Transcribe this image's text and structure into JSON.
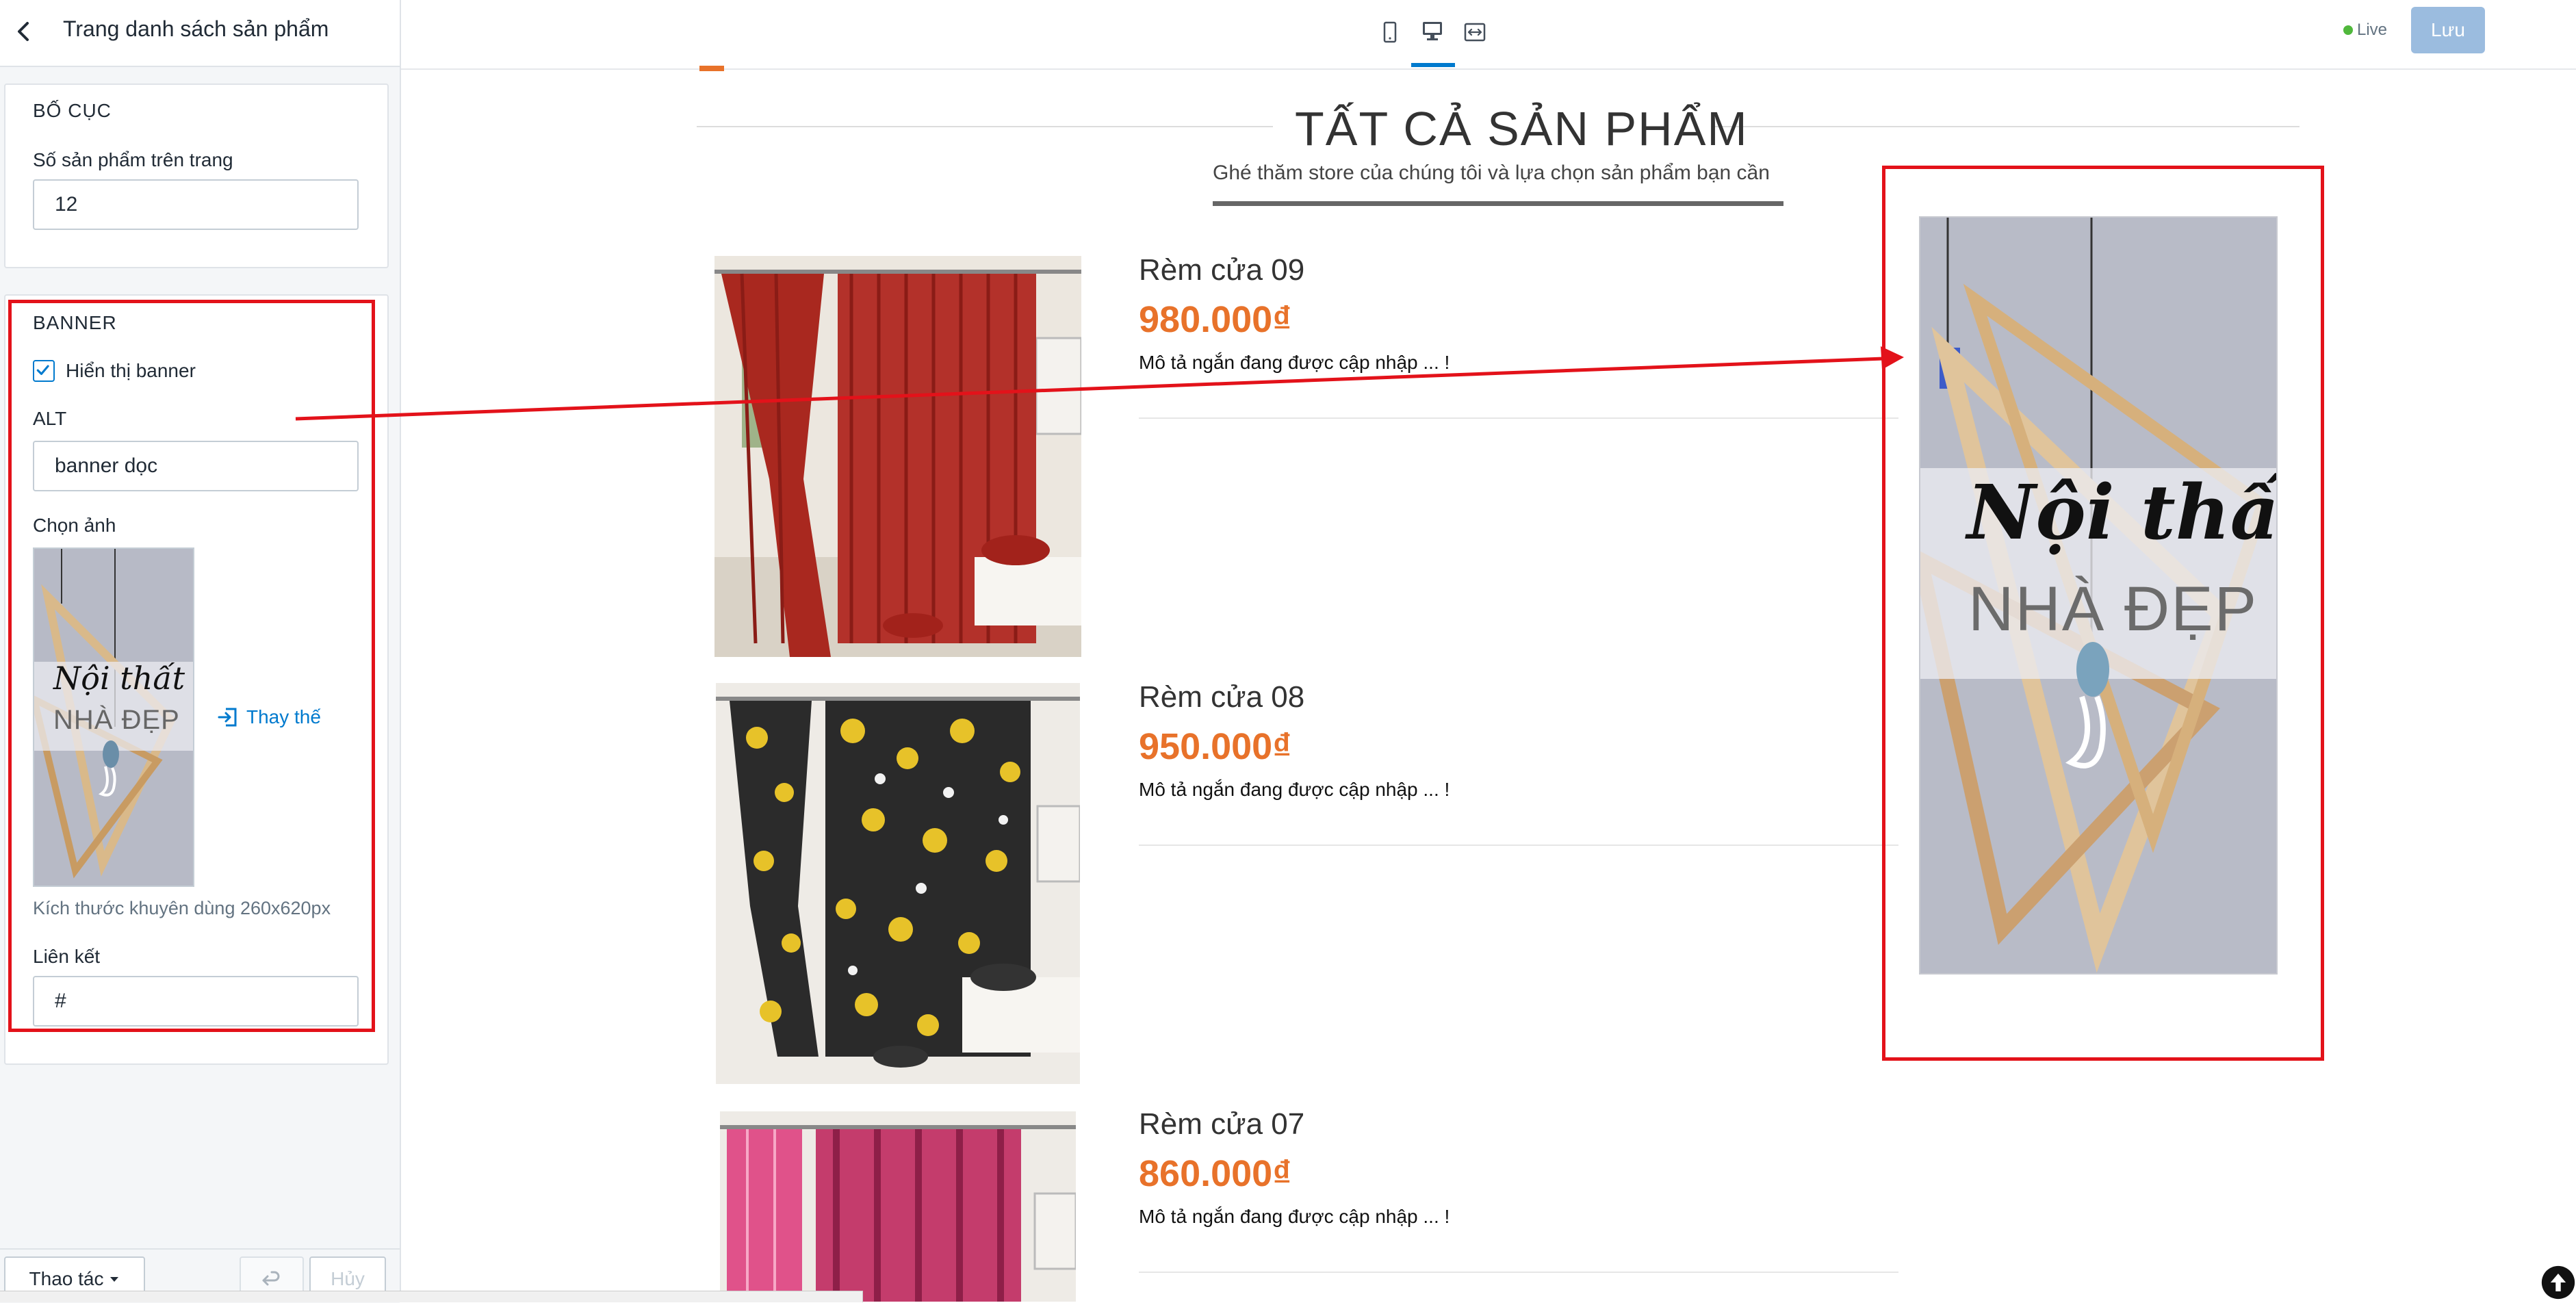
{
  "sidebar": {
    "title": "Trang danh sách sản phẩm",
    "layout": {
      "heading": "BỐ CỤC",
      "per_page_label": "Số sản phẩm trên trang",
      "per_page_value": "12"
    },
    "banner": {
      "heading": "BANNER",
      "show_label": "Hiển thị banner",
      "show_checked": true,
      "alt_label": "ALT",
      "alt_value": "banner dọc",
      "image_label": "Chọn ảnh",
      "replace_label": "Thay thế",
      "size_hint": "Kích thước khuyên dùng 260x620px",
      "link_label": "Liên kết",
      "link_value": "#"
    },
    "footer": {
      "actions_label": "Thao tác",
      "cancel_label": "Hủy"
    }
  },
  "topbar": {
    "live_label": "Live",
    "save_label": "Lưu",
    "devices": [
      "mobile-icon",
      "desktop-icon",
      "fullwidth-icon"
    ],
    "active_device": "desktop-icon"
  },
  "preview": {
    "section_title": "TẤT CẢ SẢN PHẨM",
    "section_subtitle": "Ghé thăm store của chúng tôi và lựa chọn sản phẩm bạn cần",
    "products": [
      {
        "name": "Rèm cửa 09",
        "price": "980.000₫",
        "desc": "Mô tả ngắn đang được cập nhập ... !"
      },
      {
        "name": "Rèm cửa 08",
        "price": "950.000₫",
        "desc": "Mô tả ngắn đang được cập nhập ... !"
      },
      {
        "name": "Rèm cửa 07",
        "price": "860.000₫",
        "desc": "Mô tả ngắn đang được cập nhập ... !"
      }
    ],
    "banner_image": {
      "script_text": "Nội thất",
      "caps_text": "NHÀ ĐẸP"
    }
  },
  "colors": {
    "accent": "#e8722a",
    "annotation_red": "#e3121a",
    "save_button": "#9bbcdf",
    "live_dot": "#50b83c",
    "link_blue": "#007ace"
  }
}
